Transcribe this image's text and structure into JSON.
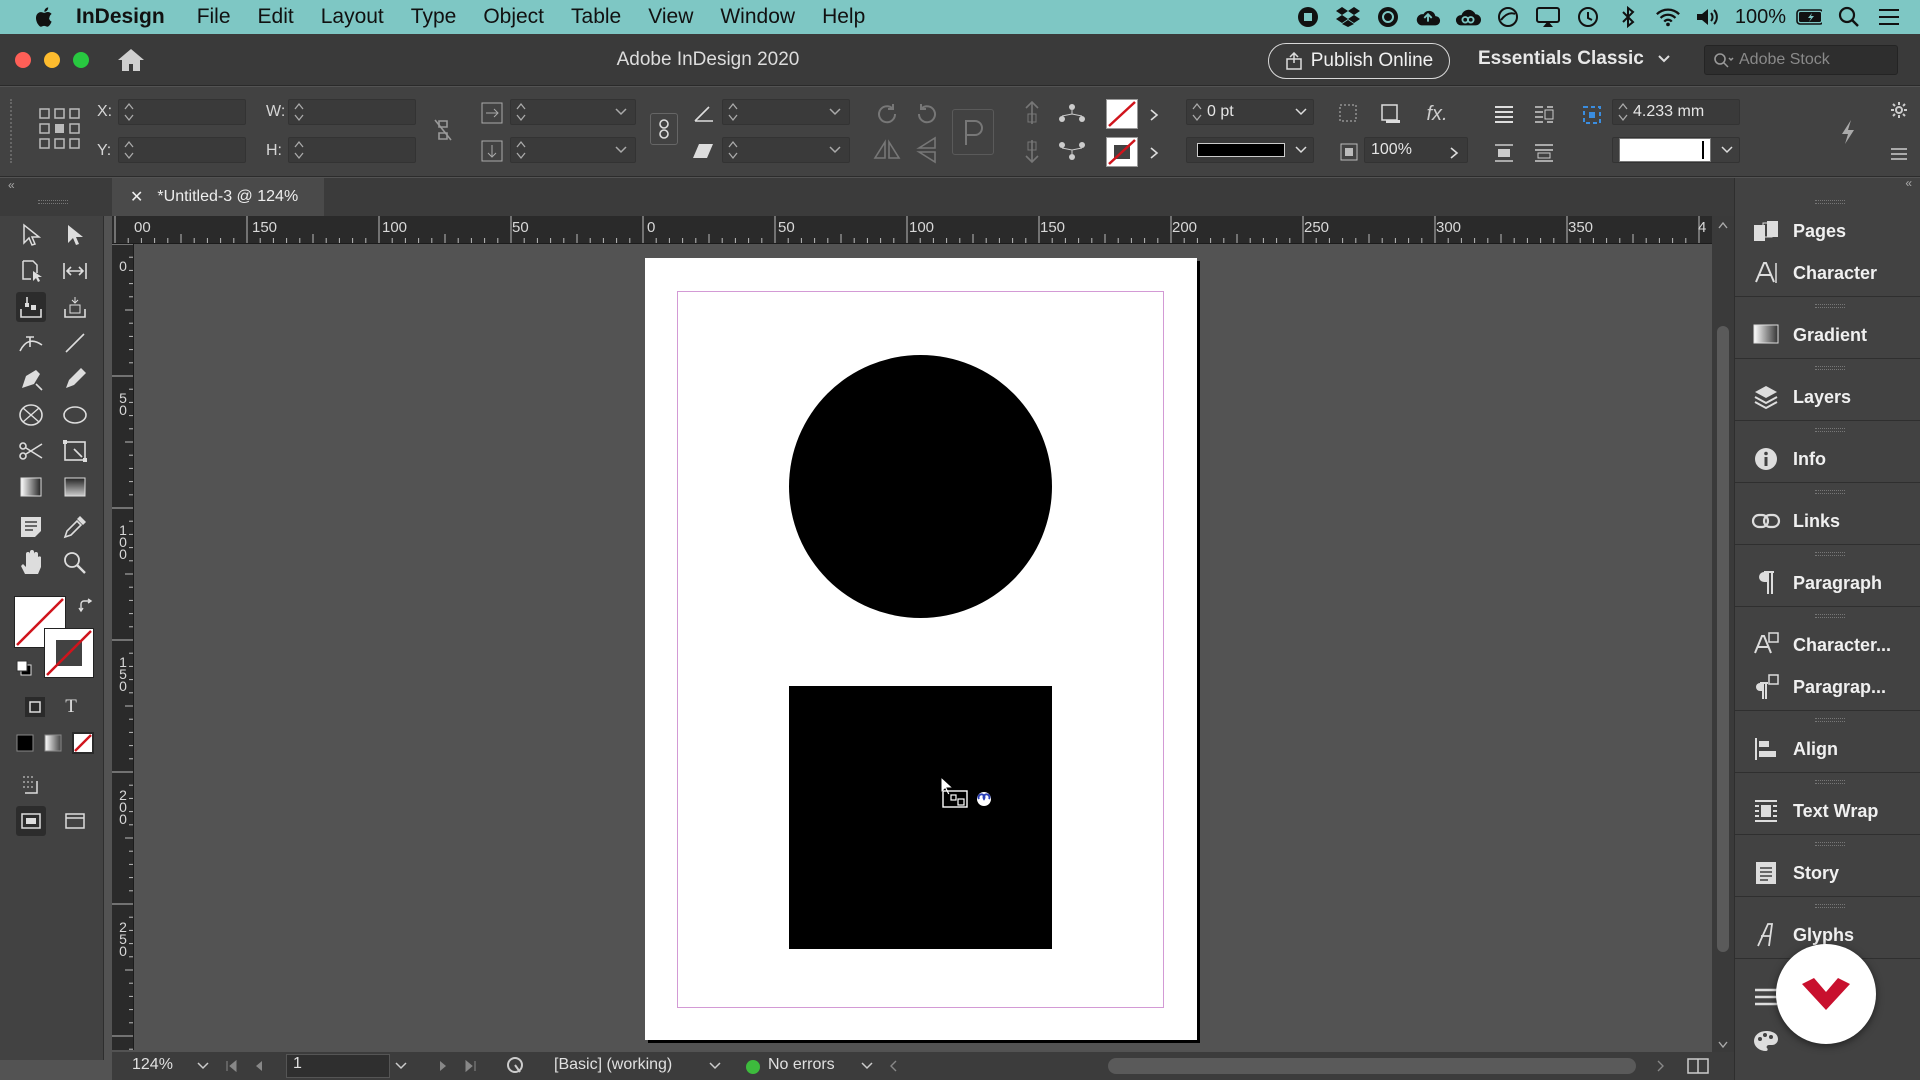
{
  "menubar": {
    "app_name": "InDesign",
    "menus": [
      "File",
      "Edit",
      "Layout",
      "Type",
      "Object",
      "Table",
      "View",
      "Window",
      "Help"
    ],
    "battery": "100%"
  },
  "titlebar": {
    "title": "Adobe InDesign 2020",
    "publish_label": "Publish Online",
    "workspace": "Essentials Classic",
    "stock_placeholder": "Adobe Stock"
  },
  "control": {
    "x_label": "X:",
    "y_label": "Y:",
    "w_label": "W:",
    "h_label": "H:",
    "stroke_weight": "0 pt",
    "opacity": "100%",
    "offset": "4.233 mm"
  },
  "tab": {
    "title": "*Untitled-3 @ 124%"
  },
  "ruler": {
    "h_labels": [
      "00",
      "150",
      "100",
      "50",
      "0",
      "50",
      "100",
      "150",
      "200",
      "250",
      "300",
      "350",
      "4"
    ],
    "v_labels": [
      "0",
      "5 0",
      "1 0 0",
      "1 5 0",
      "2 0 0",
      "2 5 0"
    ]
  },
  "statusbar": {
    "zoom": "124%",
    "page": "1",
    "style": "[Basic] (working)",
    "preflight": "No errors"
  },
  "dock": {
    "items": [
      "Pages",
      "Character",
      "Gradient",
      "Layers",
      "Info",
      "Links",
      "Paragraph",
      "Character...",
      "Paragrap...",
      "Align",
      "Text Wrap",
      "Story",
      "Glyphs"
    ]
  },
  "colors": {
    "menubar_bg": "#7ec7c4",
    "accent": "#c8102e"
  }
}
